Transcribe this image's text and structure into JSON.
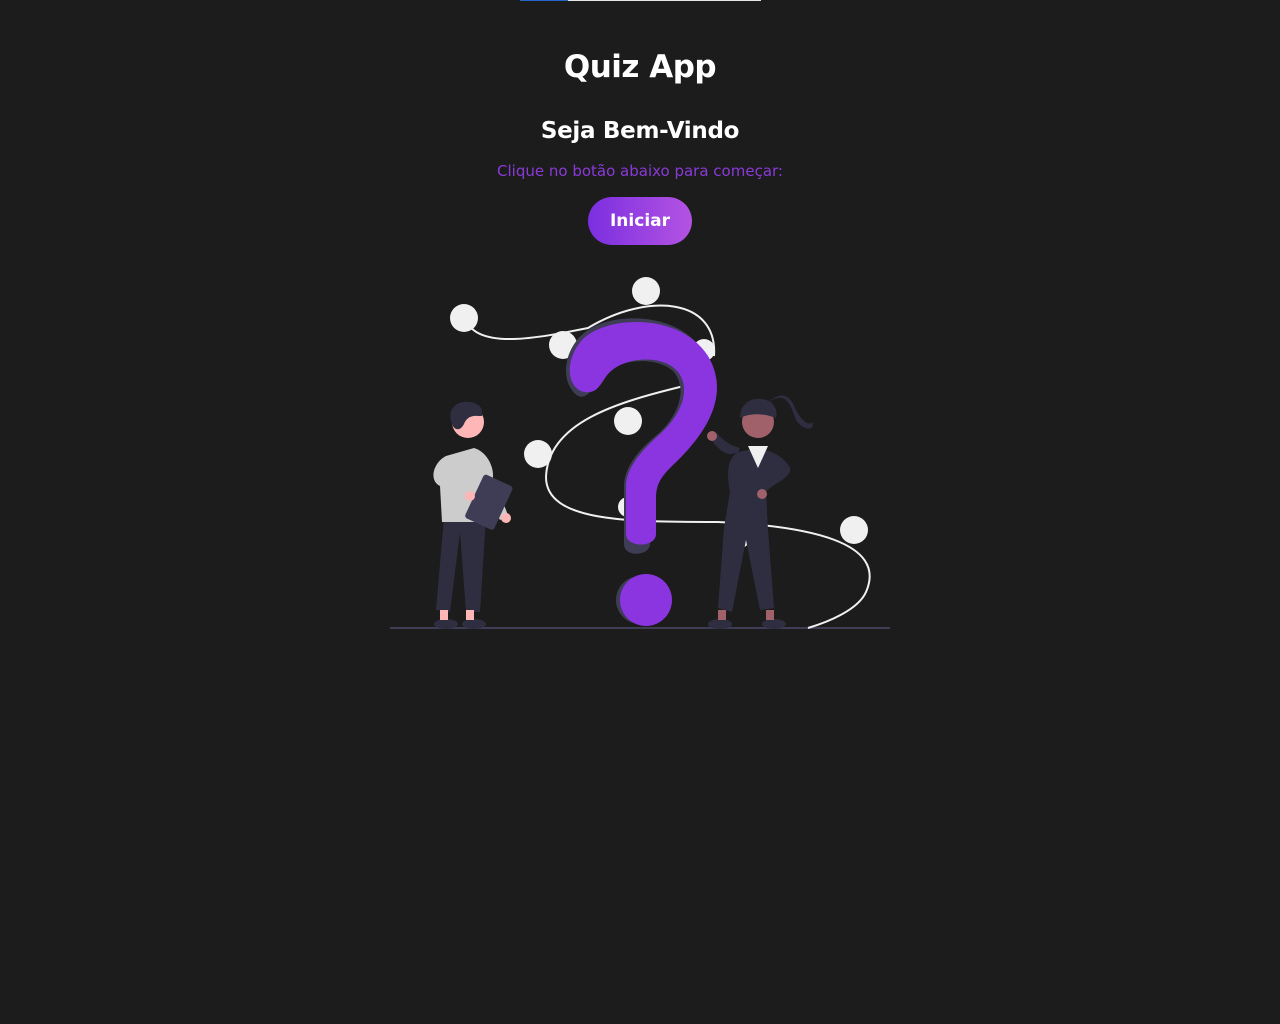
{
  "progress": {
    "value": 0.2
  },
  "header": {
    "title": "Quiz App"
  },
  "welcome": {
    "title": "Seja Bem-Vindo",
    "instruction": "Clique no botão abaixo para começar:",
    "start_label": "Iniciar"
  },
  "colors": {
    "background": "#1c1c1c",
    "accent": "#8a3ad8",
    "button_gradient_start": "#7b2fe0",
    "button_gradient_end": "#b453e2"
  },
  "illustration": {
    "icon": "question-mark-people-illustration"
  }
}
